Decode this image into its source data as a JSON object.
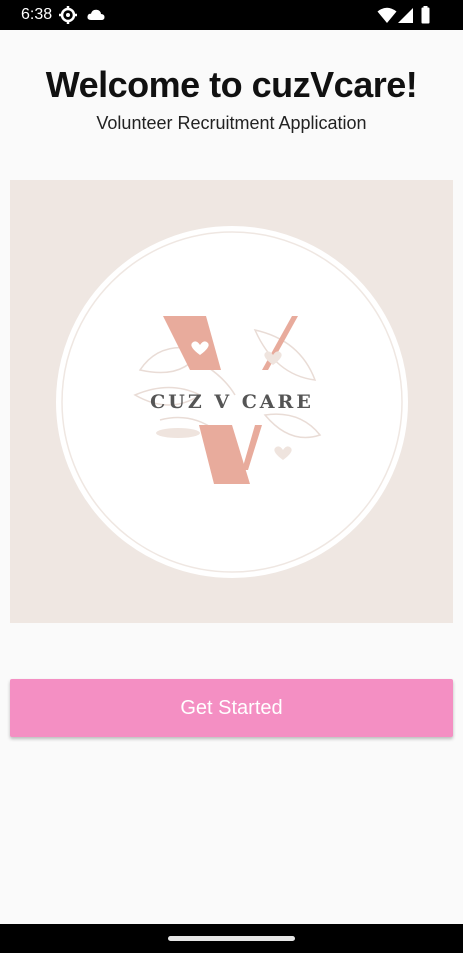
{
  "status_bar": {
    "time": "6:38",
    "icons": [
      "settings-gear-icon",
      "cloud-icon",
      "wifi-icon",
      "cellular-signal-icon",
      "battery-icon"
    ]
  },
  "header": {
    "title": "Welcome to cuzVcare!",
    "subtitle": "Volunteer Recruitment Application"
  },
  "logo": {
    "text": "CUZ V CARE",
    "colors": {
      "panel_background": "#efe7e2",
      "circle_fill": "#ffffff",
      "ring": "#efe7e2",
      "v_shape": "#e8ab9c",
      "text": "#555555"
    }
  },
  "actions": {
    "get_started_label": "Get Started",
    "button_color": "#f48fc3"
  }
}
